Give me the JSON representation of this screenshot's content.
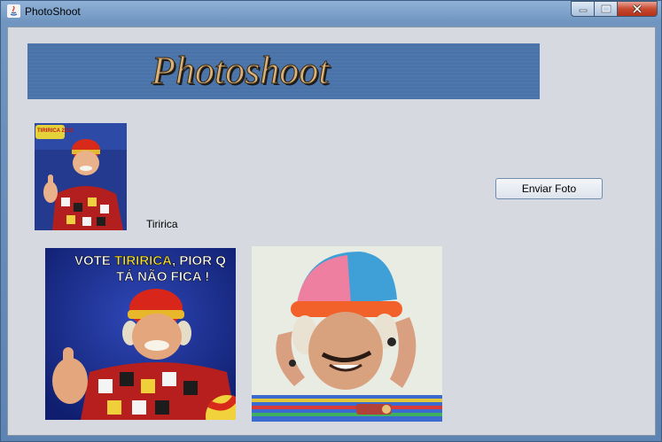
{
  "window": {
    "title": "PhotoShoot",
    "controls": {
      "minimize": "minimize",
      "maximize": "maximize",
      "close": "close"
    }
  },
  "banner": {
    "text": "Photoshoot",
    "colors": {
      "background": "#4a73a9",
      "text": "#d8b27a",
      "outline": "#1c1c1c"
    }
  },
  "profile": {
    "name": "Tiririca",
    "thumbnail_badge": "TIRIRICA 2222"
  },
  "actions": {
    "send_photo_label": "Enviar Foto"
  },
  "photos": [
    {
      "caption_line1_a": "VOTE ",
      "caption_line1_b": "TIRIRICA",
      "caption_line1_c": ", PIOR Q",
      "caption_line2": "TÁ NÃO FICA !"
    },
    {}
  ],
  "colors": {
    "client_bg": "#d6d9df",
    "button_border": "#6f8db0",
    "photo1_bg": "#1b2f8a",
    "photo2_bg": "#e8ece2"
  }
}
